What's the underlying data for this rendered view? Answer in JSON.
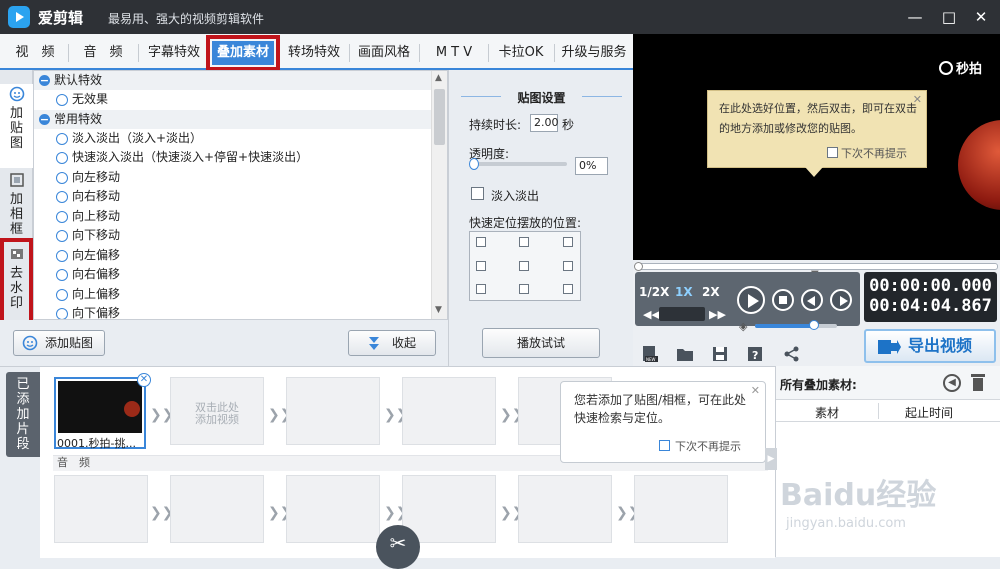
{
  "app": {
    "name": "爱剪辑",
    "slogan": "最易用、强大的视频剪辑软件"
  },
  "tabs": [
    "视　频",
    "音　频",
    "字幕特效",
    "叠加素材",
    "转场特效",
    "画面风格",
    "M T V",
    "卡拉OK",
    "升级与服务"
  ],
  "active_tab": "叠加素材",
  "side_tabs": [
    "加贴图",
    "加相框",
    "去水印"
  ],
  "effects": {
    "group_default": "默认特效",
    "none": "无效果",
    "group_common": "常用特效",
    "items": [
      "淡入淡出（淡入+淡出）",
      "快速淡入淡出（快速淡入+停留+快速淡出）",
      "向左移动",
      "向右移动",
      "向上移动",
      "向下移动",
      "向左偏移",
      "向右偏移",
      "向上偏移",
      "向下偏移"
    ]
  },
  "left_buttons": {
    "add_sticker": "添加贴图",
    "collapse": "收起"
  },
  "sticker_settings": {
    "title": "贴图设置",
    "duration_label": "持续时长:",
    "duration_value": "2.00",
    "duration_unit": "秒",
    "opacity_label": "透明度:",
    "opacity_value": "0%",
    "fade_label": "淡入淡出",
    "position_label": "快速定位摆放的位置:",
    "preview_button": "播放试试"
  },
  "preview": {
    "brand": "秒拍",
    "tooltip_text": "在此处选好位置，然后双击，即可在双击的地方添加或修改您的贴图。",
    "no_remind": "下次不再提示",
    "progress": 0.0
  },
  "playback": {
    "speeds": [
      "1/2X",
      "1X",
      "2X"
    ],
    "active_speed": "1X",
    "time_current": "00:00:00.000",
    "time_total": "00:04:04.867",
    "volume": 0.72,
    "export_label": "导出视频"
  },
  "clips": {
    "sidebar_label": "已添加片段",
    "first_clip_name": "0001.秒拍-挑...",
    "add_hint": "双击此处\n添加视频",
    "audio_label": "音　频",
    "tooltip_text": "您若添加了贴图/相框，可在此处快速检索与定位。",
    "no_remind": "下次不再提示"
  },
  "added_materials": {
    "title": "所有叠加素材:",
    "col_material": "素材",
    "col_start": "起止时间"
  },
  "watermark": {
    "line1": "Baidu经验",
    "line2": "jingyan.baidu.com"
  },
  "colors": {
    "accent": "#3a86d9",
    "highlight": "#c0141b",
    "titlebar": "#2e3136"
  }
}
